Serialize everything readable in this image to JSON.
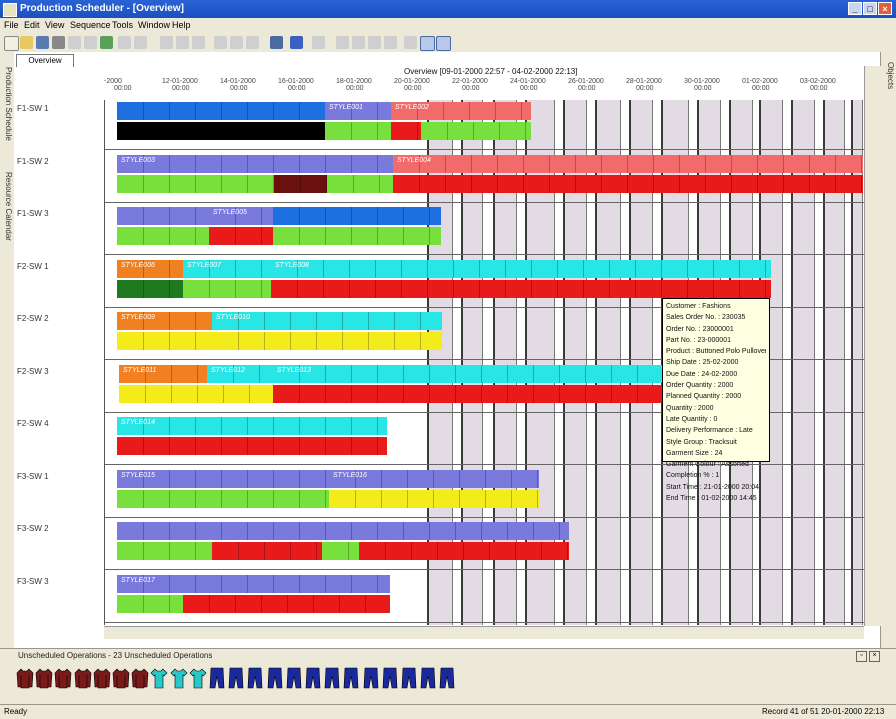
{
  "window": {
    "title": "Production Scheduler - [Overview]"
  },
  "menu": [
    "File",
    "Edit",
    "View",
    "Sequence",
    "Tools",
    "Window",
    "Help"
  ],
  "left_tabs": [
    "Production Schedule",
    "Resource Calendar"
  ],
  "right_tab": "Objects",
  "doc_tab": "Overview",
  "gantt": {
    "title": "Overview    [09-01-2000 22:57 - 04-02-2000 22:13]",
    "ticks": [
      {
        "date": "-2000",
        "time": "00:00"
      },
      {
        "date": "12-01-2000",
        "time": "00:00"
      },
      {
        "date": "14-01-2000",
        "time": "00:00"
      },
      {
        "date": "16-01-2000",
        "time": "00:00"
      },
      {
        "date": "18-01-2000",
        "time": "00:00"
      },
      {
        "date": "20-01-2000",
        "time": "00:00"
      },
      {
        "date": "22-01-2000",
        "time": "00:00"
      },
      {
        "date": "24-01-2000",
        "time": "00:00"
      },
      {
        "date": "26-01-2000",
        "time": "00:00"
      },
      {
        "date": "28-01-2000",
        "time": "00:00"
      },
      {
        "date": "30-01-2000",
        "time": "00:00"
      },
      {
        "date": "01-02-2000",
        "time": "00:00"
      },
      {
        "date": "03-02-2000",
        "time": "00:00"
      }
    ],
    "rows": [
      {
        "label": "F1-SW 1",
        "bars": [
          {
            "color": "#1e6fe0",
            "start": 12,
            "len": 208,
            "lane": 0,
            "text": ""
          },
          {
            "color": "#7a7adc",
            "start": 220,
            "len": 66,
            "lane": 0,
            "text": "STYLE001"
          },
          {
            "color": "#f26b6b",
            "start": 286,
            "len": 140,
            "lane": 0,
            "text": "STYLE002"
          },
          {
            "color": "#000000",
            "start": 12,
            "len": 208,
            "lane": 1,
            "text": ""
          },
          {
            "color": "#77e03c",
            "start": 220,
            "len": 66,
            "lane": 1,
            "text": ""
          },
          {
            "color": "#e81a1a",
            "start": 286,
            "len": 30,
            "lane": 1,
            "text": ""
          },
          {
            "color": "#77e03c",
            "start": 316,
            "len": 110,
            "lane": 1,
            "text": ""
          }
        ]
      },
      {
        "label": "F1-SW 2",
        "bars": [
          {
            "color": "#7a7adc",
            "start": 12,
            "len": 276,
            "lane": 0,
            "text": "STYLE003"
          },
          {
            "color": "#f26b6b",
            "start": 288,
            "len": 470,
            "lane": 0,
            "text": "STYLE004"
          },
          {
            "color": "#77e03c",
            "start": 12,
            "len": 157,
            "lane": 1,
            "text": ""
          },
          {
            "color": "#6b0f0f",
            "start": 169,
            "len": 53,
            "lane": 1,
            "text": ""
          },
          {
            "color": "#77e03c",
            "start": 222,
            "len": 66,
            "lane": 1,
            "text": ""
          },
          {
            "color": "#e81a1a",
            "start": 288,
            "len": 470,
            "lane": 1,
            "text": ""
          }
        ]
      },
      {
        "label": "F1-SW 3",
        "bars": [
          {
            "color": "#7a7adc",
            "start": 12,
            "len": 92,
            "lane": 0,
            "text": ""
          },
          {
            "color": "#7a7adc",
            "start": 104,
            "len": 64,
            "lane": 0,
            "text": "STYLE005"
          },
          {
            "color": "#1e6fe0",
            "start": 168,
            "len": 168,
            "lane": 0,
            "text": ""
          },
          {
            "color": "#77e03c",
            "start": 12,
            "len": 92,
            "lane": 1,
            "text": ""
          },
          {
            "color": "#e81a1a",
            "start": 104,
            "len": 64,
            "lane": 1,
            "text": ""
          },
          {
            "color": "#77e03c",
            "start": 168,
            "len": 168,
            "lane": 1,
            "text": ""
          }
        ]
      },
      {
        "label": "F2-SW 1",
        "bars": [
          {
            "color": "#f08020",
            "start": 12,
            "len": 66,
            "lane": 0,
            "text": "STYLE006"
          },
          {
            "color": "#29e6e6",
            "start": 78,
            "len": 88,
            "lane": 0,
            "text": "STYLE007"
          },
          {
            "color": "#29e6e6",
            "start": 166,
            "len": 500,
            "lane": 0,
            "text": "STYLE008"
          },
          {
            "color": "#1f7a1f",
            "start": 12,
            "len": 66,
            "lane": 1,
            "text": ""
          },
          {
            "color": "#77e03c",
            "start": 78,
            "len": 88,
            "lane": 1,
            "text": ""
          },
          {
            "color": "#e81a1a",
            "start": 166,
            "len": 500,
            "lane": 1,
            "text": ""
          }
        ]
      },
      {
        "label": "F2-SW 2",
        "bars": [
          {
            "color": "#f08020",
            "start": 12,
            "len": 95,
            "lane": 0,
            "text": "STYLE009"
          },
          {
            "color": "#29e6e6",
            "start": 107,
            "len": 230,
            "lane": 0,
            "text": "STYLE010"
          },
          {
            "color": "#f4ec1a",
            "start": 12,
            "len": 95,
            "lane": 1,
            "text": ""
          },
          {
            "color": "#f4ec1a",
            "start": 107,
            "len": 230,
            "lane": 1,
            "text": ""
          }
        ]
      },
      {
        "label": "F2-SW 3",
        "bars": [
          {
            "color": "#f08020",
            "start": 14,
            "len": 88,
            "lane": 0,
            "text": "STYLE011"
          },
          {
            "color": "#29e6e6",
            "start": 102,
            "len": 66,
            "lane": 0,
            "text": "STYLE012"
          },
          {
            "color": "#29e6e6",
            "start": 168,
            "len": 390,
            "lane": 0,
            "text": "STYLE013"
          },
          {
            "color": "#f4ec1a",
            "start": 14,
            "len": 154,
            "lane": 1,
            "text": ""
          },
          {
            "color": "#e81a1a",
            "start": 168,
            "len": 390,
            "lane": 1,
            "text": ""
          }
        ]
      },
      {
        "label": "F2-SW 4",
        "bars": [
          {
            "color": "#29e6e6",
            "start": 12,
            "len": 270,
            "lane": 0,
            "text": "STYLE014"
          },
          {
            "color": "#e81a1a",
            "start": 12,
            "len": 270,
            "lane": 1,
            "text": ""
          }
        ]
      },
      {
        "label": "F3-SW 1",
        "bars": [
          {
            "color": "#7a7adc",
            "start": 12,
            "len": 212,
            "lane": 0,
            "text": "STYLE015"
          },
          {
            "color": "#7a7adc",
            "start": 224,
            "len": 210,
            "lane": 0,
            "text": "STYLE016"
          },
          {
            "color": "#77e03c",
            "start": 12,
            "len": 212,
            "lane": 1,
            "text": ""
          },
          {
            "color": "#f4ec1a",
            "start": 224,
            "len": 210,
            "lane": 1,
            "text": ""
          }
        ]
      },
      {
        "label": "F3-SW 2",
        "bars": [
          {
            "color": "#7a7adc",
            "start": 12,
            "len": 452,
            "lane": 0,
            "text": ""
          },
          {
            "color": "#77e03c",
            "start": 12,
            "len": 95,
            "lane": 1,
            "text": ""
          },
          {
            "color": "#e81a1a",
            "start": 107,
            "len": 110,
            "lane": 1,
            "text": ""
          },
          {
            "color": "#77e03c",
            "start": 217,
            "len": 37,
            "lane": 1,
            "text": ""
          },
          {
            "color": "#e81a1a",
            "start": 254,
            "len": 210,
            "lane": 1,
            "text": ""
          }
        ]
      },
      {
        "label": "F3-SW 3",
        "bars": [
          {
            "color": "#7a7adc",
            "start": 12,
            "len": 273,
            "lane": 0,
            "text": "STYLE017"
          },
          {
            "color": "#77e03c",
            "start": 12,
            "len": 66,
            "lane": 1,
            "text": ""
          },
          {
            "color": "#e81a1a",
            "start": 78,
            "len": 207,
            "lane": 1,
            "text": ""
          }
        ]
      }
    ]
  },
  "tooltip": [
    "Customer : Fashions",
    "Sales Order No. : 230035",
    "Order No. : 23000001",
    "Part No. : 23-000001",
    "Product : Buttoned Polo Pullover",
    "Ship Date : 25-02-2000",
    "Due Date : 24-02-2000",
    "Order Quantity : 2000",
    "Planned Quantity : 2000",
    "Quantity : 2000",
    "Late Quantity : 0",
    "Delivery Performance : Late",
    "Style Group : Tracksuit",
    "Garment Size : 24",
    "Garment Colour : Assorted",
    "Completion % : 1",
    "Start Time : 21-01-2000 20:04",
    "End Time : 01-02-2000 14:45"
  ],
  "bottom_panel": {
    "title": "Unscheduled Operations - 23 Unscheduled Operations",
    "garments": [
      "jacket",
      "jacket",
      "jacket",
      "jacket",
      "jacket",
      "jacket",
      "jacket",
      "tshirt",
      "tshirt",
      "tshirt",
      "trousers",
      "trousers",
      "trousers",
      "trousers",
      "trousers",
      "trousers",
      "trousers",
      "trousers",
      "trousers",
      "trousers",
      "trousers",
      "trousers",
      "trousers"
    ]
  },
  "status": {
    "left": "Ready",
    "right": "Record 41 of 51    20-01-2000 22:13"
  },
  "colors": {
    "grid_col": "#e3dbe3",
    "title_blue": "#1c4fc0"
  }
}
